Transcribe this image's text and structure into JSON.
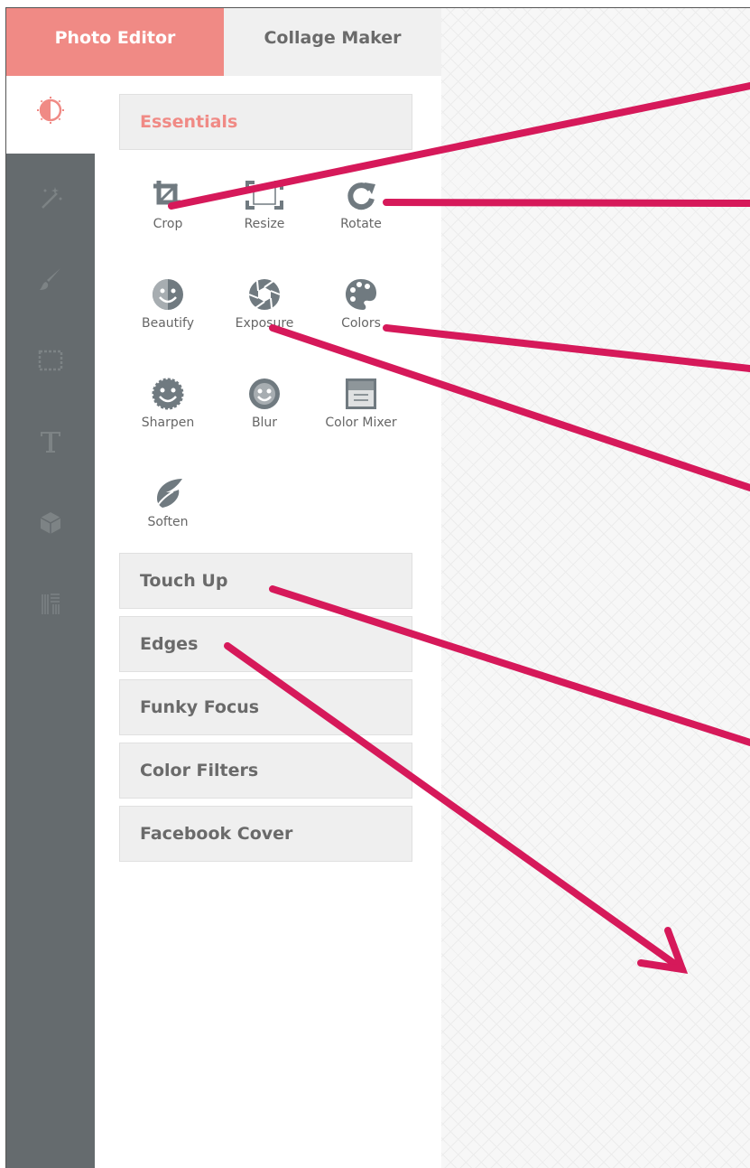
{
  "tabs": {
    "photo_editor": "Photo Editor",
    "collage_maker": "Collage Maker"
  },
  "toolbar": {
    "icons": [
      "adjust-icon",
      "magic-wand-icon",
      "brush-icon",
      "frame-icon",
      "text-icon",
      "cube-icon",
      "texture-icon"
    ]
  },
  "panel": {
    "essentials": "Essentials",
    "tools": {
      "crop": "Crop",
      "resize": "Resize",
      "rotate": "Rotate",
      "beautify": "Beautify",
      "exposure": "Exposure",
      "colors": "Colors",
      "sharpen": "Sharpen",
      "blur": "Blur",
      "color_mixer": "Color Mixer",
      "soften": "Soften"
    },
    "sections": {
      "touch_up": "Touch Up",
      "edges": "Edges",
      "funky_focus": "Funky Focus",
      "color_filters": "Color Filters",
      "facebook_cover": "Facebook Cover"
    }
  },
  "colors": {
    "accent": "#f08a85",
    "annotation_arrow": "#d6195a",
    "toolbar_bg": "#656b6e"
  }
}
